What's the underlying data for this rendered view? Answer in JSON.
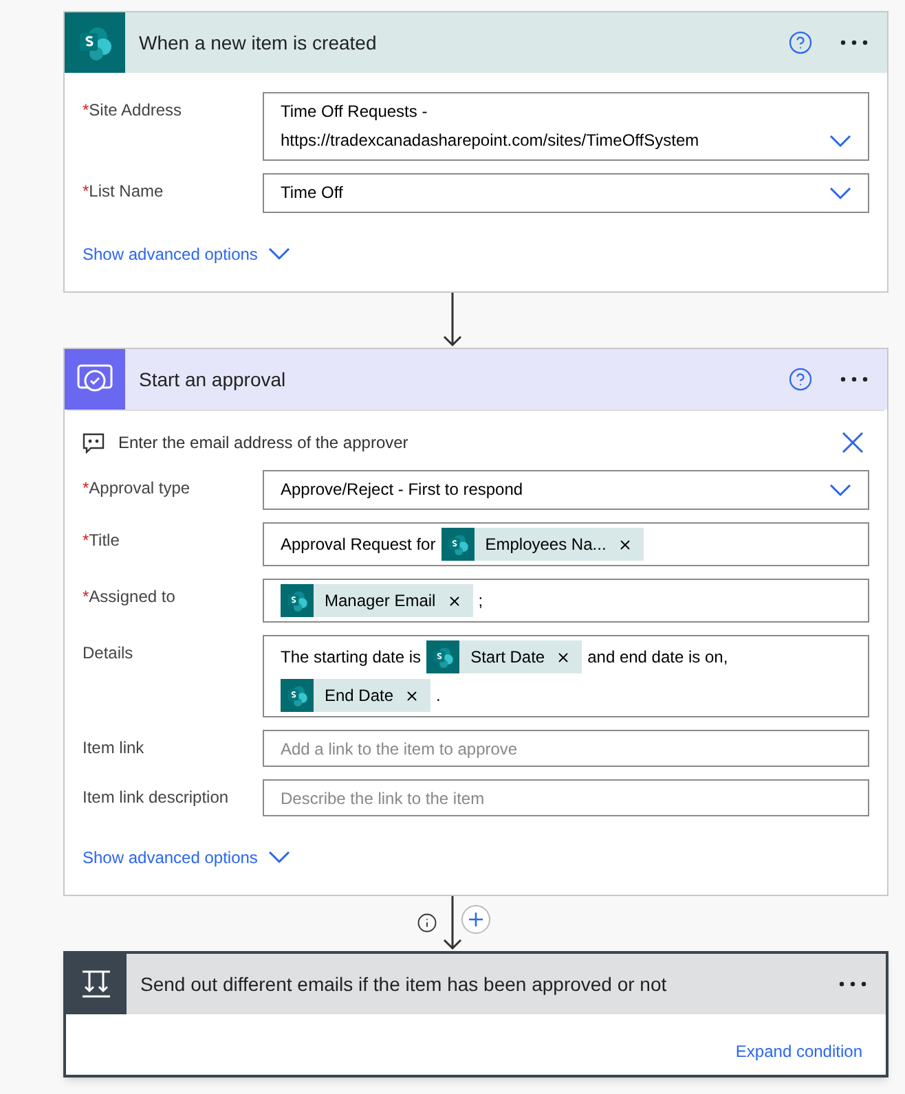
{
  "cards": [
    {
      "kind": "sharepoint",
      "title": "When a new item is created",
      "help": true,
      "fields": [
        {
          "label": "Site Address",
          "required": "*",
          "kind": "dropdown",
          "parts": [
            {
              "kind": "line",
              "text": "Time Off Requests -"
            },
            {
              "kind": "line",
              "text": "https://tradexcanadasharepoint.com/sites/TimeOffSystem"
            }
          ]
        },
        {
          "label": "List Name",
          "required": "*",
          "kind": "dropdown",
          "parts": [
            {
              "kind": "line",
              "text": "Time Off"
            }
          ]
        }
      ],
      "advanced": "Show advanced options"
    },
    {
      "kind": "approval",
      "title": "Start an approval",
      "help": true,
      "hint": "Enter the email address of the approver",
      "fields": [
        {
          "label": "Approval type",
          "required": "*",
          "kind": "dropdown",
          "parts": [
            {
              "kind": "line",
              "text": "Approve/Reject - First to respond"
            }
          ]
        },
        {
          "label": "Title",
          "required": "*",
          "kind": "text",
          "parts": [
            {
              "kind": "text",
              "text": "Approval Request for"
            },
            {
              "kind": "token",
              "text": "Employees Na..."
            }
          ]
        },
        {
          "label": "Assigned to",
          "required": "*",
          "kind": "text",
          "parts": [
            {
              "kind": "token",
              "text": "Manager Email"
            },
            {
              "kind": "text",
              "text": ";"
            }
          ]
        },
        {
          "label": "Details",
          "kind": "text",
          "parts": [
            {
              "kind": "text",
              "text": "The starting date is"
            },
            {
              "kind": "token",
              "text": "Start Date"
            },
            {
              "kind": "text",
              "text": "and end date is on,"
            },
            {
              "kind": "token",
              "text": "End Date"
            },
            {
              "kind": "text",
              "text": "."
            }
          ]
        },
        {
          "label": "Item link",
          "kind": "text",
          "placeholder": "Add a link to the item to approve"
        },
        {
          "label": "Item link description",
          "kind": "text",
          "placeholder": "Describe the link to the item"
        }
      ],
      "advanced": "Show advanced options"
    },
    {
      "kind": "condition",
      "title": "Send out different emails if the item has been approved or not",
      "help": false,
      "link": "Expand condition"
    }
  ]
}
